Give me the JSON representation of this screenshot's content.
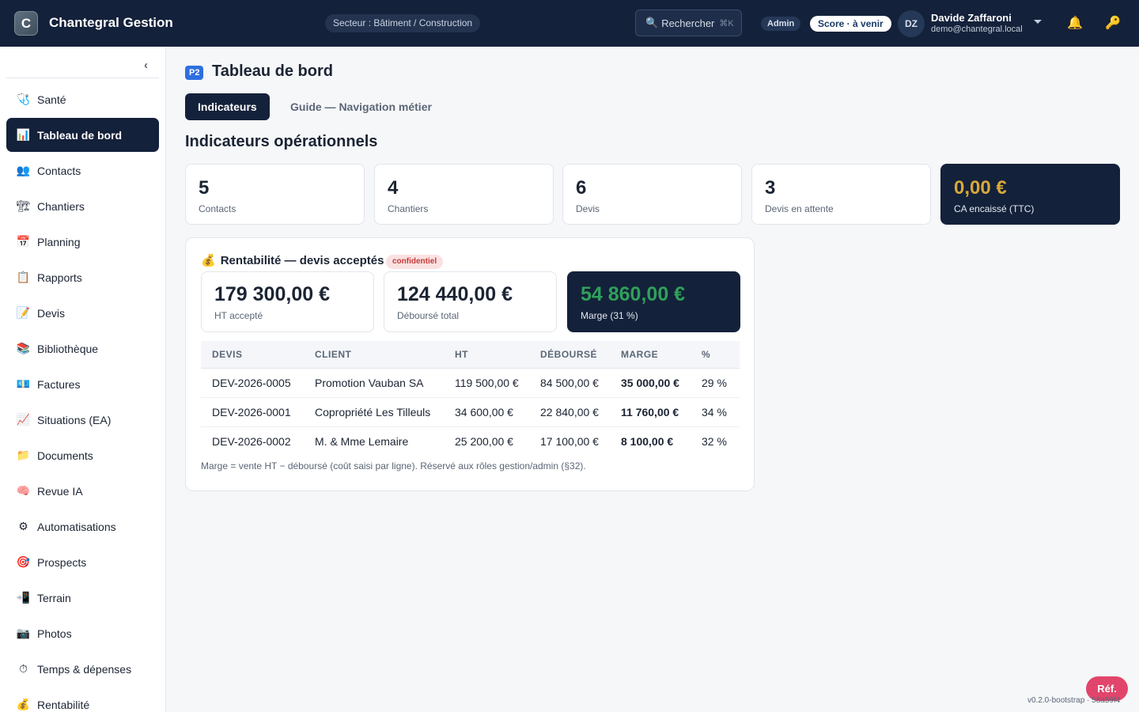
{
  "header": {
    "logo_letter": "C",
    "app_title": "Chantegral Gestion",
    "sector": "Secteur : Bâtiment / Construction",
    "search_label": "Rechercher",
    "search_shortcut": "⌘K",
    "role": "Admin",
    "score": "Score · à venir",
    "avatar_initials": "DZ",
    "user_name": "Davide Zaffaroni",
    "user_email": "demo@chantegral.local",
    "icons": [
      "search-icon",
      "chevron-down-icon",
      "bell-icon",
      "key-icon"
    ]
  },
  "sidebar": {
    "items": [
      {
        "label": "Santé",
        "icon": "🩺"
      },
      {
        "label": "Tableau de bord",
        "icon": "📊"
      },
      {
        "label": "Contacts",
        "icon": "👥"
      },
      {
        "label": "Chantiers",
        "icon": "🏗"
      },
      {
        "label": "Planning",
        "icon": "📅"
      },
      {
        "label": "Rapports",
        "icon": "📋"
      },
      {
        "label": "Devis",
        "icon": "📝"
      },
      {
        "label": "Bibliothèque",
        "icon": "📚"
      },
      {
        "label": "Factures",
        "icon": "💶"
      },
      {
        "label": "Situations (EA)",
        "icon": "📈"
      },
      {
        "label": "Documents",
        "icon": "📁"
      },
      {
        "label": "Revue IA",
        "icon": "🧠"
      },
      {
        "label": "Automatisations",
        "icon": "⚙"
      },
      {
        "label": "Prospects",
        "icon": "🎯"
      },
      {
        "label": "Terrain",
        "icon": "📲"
      },
      {
        "label": "Photos",
        "icon": "📷"
      },
      {
        "label": "Temps & dépenses",
        "icon": "⏱"
      },
      {
        "label": "Rentabilité",
        "icon": "💰"
      }
    ],
    "active_index": 1,
    "collapse_label": "‹"
  },
  "main": {
    "badge": "P2",
    "title": "Tableau de bord",
    "tabs": [
      {
        "label": "Indicateurs",
        "active": true
      },
      {
        "label": "Guide — Navigation métier",
        "active": false
      }
    ],
    "section_title": "Indicateurs opérationnels",
    "kpis": [
      {
        "value": "5",
        "label": "Contacts"
      },
      {
        "value": "4",
        "label": "Chantiers"
      },
      {
        "value": "6",
        "label": "Devis"
      },
      {
        "value": "3",
        "label": "Devis en attente"
      },
      {
        "value": "0,00 €",
        "label": "CA encaissé (TTC)"
      }
    ],
    "profitability": {
      "icon": "💰",
      "title": "Rentabilité — devis acceptés",
      "badge": "confidentiel",
      "stats": [
        {
          "value": "179 300,00 €",
          "label": "HT accepté"
        },
        {
          "value": "124 440,00 €",
          "label": "Déboursé total"
        },
        {
          "value": "54 860,00 €",
          "label": "Marge (31 %)"
        }
      ],
      "columns": [
        "DEVIS",
        "CLIENT",
        "HT",
        "DÉBOURSÉ",
        "MARGE",
        "%"
      ],
      "rows": [
        {
          "devis": "DEV-2026-0005",
          "client": "Promotion Vauban SA",
          "ht": "119 500,00 €",
          "debourse": "84 500,00 €",
          "marge": "35 000,00 €",
          "pct": "29 %"
        },
        {
          "devis": "DEV-2026-0001",
          "client": "Copropriété Les Tilleuls",
          "ht": "34 600,00 €",
          "debourse": "22 840,00 €",
          "marge": "11 760,00 €",
          "pct": "34 %"
        },
        {
          "devis": "DEV-2026-0002",
          "client": "M. & Mme Lemaire",
          "ht": "25 200,00 €",
          "debourse": "17 100,00 €",
          "marge": "8 100,00 €",
          "pct": "32 %"
        }
      ],
      "footnote": "Marge = vente HT − déboursé (coût saisi par ligne). Réservé aux rôles gestion/admin (§32)."
    }
  },
  "colors": {
    "navy": "#14213a",
    "gold": "#d8a93a",
    "green": "#23994f",
    "pink": "#e2456b",
    "blue_badge": "#2f6fe0"
  },
  "footer": {
    "ref_button": "Réf.",
    "version": "v0.2.0-bootstrap · 58a59f4"
  }
}
